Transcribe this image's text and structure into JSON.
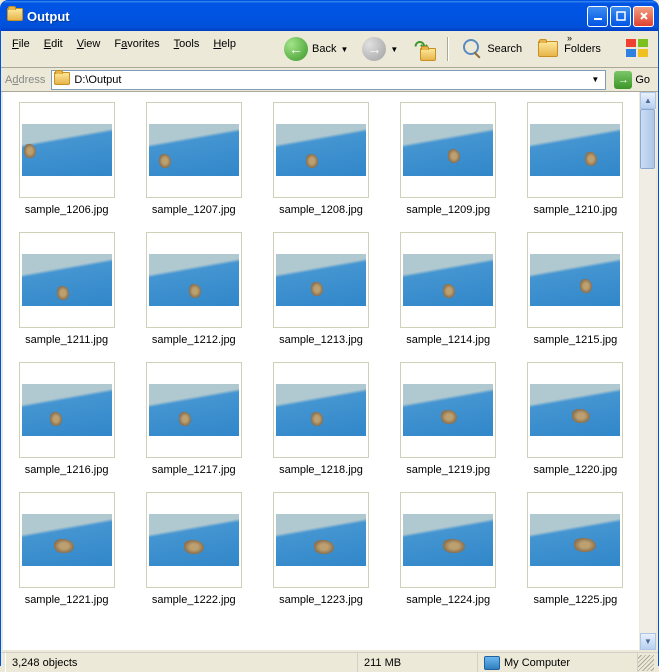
{
  "window": {
    "title": "Output"
  },
  "menu": {
    "file": "File",
    "edit": "Edit",
    "view": "View",
    "favorites": "Favorites",
    "tools": "Tools",
    "help": "Help"
  },
  "toolbar": {
    "back": "Back",
    "search": "Search",
    "folders": "Folders"
  },
  "address": {
    "label": "Address",
    "path": "D:\\Output",
    "go": "Go"
  },
  "files": [
    "sample_1206.jpg",
    "sample_1207.jpg",
    "sample_1208.jpg",
    "sample_1209.jpg",
    "sample_1210.jpg",
    "sample_1211.jpg",
    "sample_1212.jpg",
    "sample_1213.jpg",
    "sample_1214.jpg",
    "sample_1215.jpg",
    "sample_1216.jpg",
    "sample_1217.jpg",
    "sample_1218.jpg",
    "sample_1219.jpg",
    "sample_1220.jpg",
    "sample_1221.jpg",
    "sample_1222.jpg",
    "sample_1223.jpg",
    "sample_1224.jpg",
    "sample_1225.jpg"
  ],
  "status": {
    "objects": "3,248 objects",
    "size": "211 MB",
    "location": "My Computer"
  }
}
